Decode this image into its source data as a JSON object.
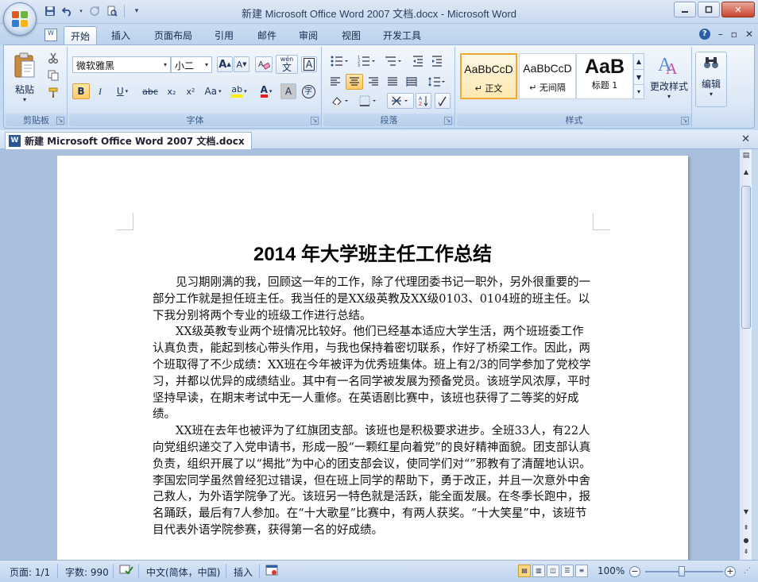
{
  "window": {
    "title": "新建 Microsoft Office Word 2007 文档.docx - Microsoft Word"
  },
  "ribbon_tabs": [
    "开始",
    "插入",
    "页面布局",
    "引用",
    "邮件",
    "审阅",
    "视图",
    "开发工具"
  ],
  "clipboard": {
    "paste_label": "粘贴",
    "group_label": "剪贴板"
  },
  "font": {
    "family": "微软雅黑",
    "size": "小二",
    "group_label": "字体",
    "grow_label": "A",
    "shrink_label": "A",
    "bold_label": "B",
    "italic_label": "I",
    "underline_label": "U",
    "strike_label": "abc",
    "subscript_label": "x₂",
    "superscript_label": "x²",
    "case_label": "Aa",
    "highlight_label": "ab",
    "color_label": "A",
    "shade_label": "A",
    "wen_label": "wén",
    "wen_char": "文",
    "border_char_label": "A",
    "enclose_label": "字"
  },
  "paragraph": {
    "group_label": "段落"
  },
  "styles": {
    "group_label": "样式",
    "items": [
      {
        "sample": "AaBbCcD",
        "name": "↵ 正文"
      },
      {
        "sample": "AaBbCcD",
        "name": "↵ 无间隔"
      },
      {
        "sample": "AaB",
        "name": "标题 1"
      }
    ],
    "change_label": "更改样式"
  },
  "editing": {
    "label": "编辑"
  },
  "doc_tab": {
    "label": "新建 Microsoft Office Word 2007 文档.docx"
  },
  "document": {
    "title": "2014 年大学班主任工作总结",
    "paragraphs": [
      "见习期刚满的我，回顾这一年的工作，除了代理团委书记一职外，另外很重要的一部分工作就是担任班主任。我当任的是XX级英教及XX级0103、0104班的班主任。以下我分别将两个专业的班级工作进行总结。",
      "XX级英教专业两个班情况比较好。他们已经基本适应大学生活，两个班班委工作认真负责，能起到核心带头作用，与我也保持着密切联系，作好了桥梁工作。因此，两个班取得了不少成绩：XX班在今年被评为优秀班集体。班上有2/3的同学参加了党校学习，并都以优异的成绩结业。其中有一名同学被发展为预备党员。该班学风浓厚，平时坚持早读，在期末考试中无一人重修。在英语剧比赛中，该班也获得了二等奖的好成绩。",
      "XX班在去年也被评为了红旗团支部。该班也是积极要求进步。全班33人，有22人向党组织递交了入党申请书，形成一股“一颗红星向着党”的良好精神面貌。团支部认真负责，组织开展了以“揭批”为中心的团支部会议，使同学们对“”邪教有了清醒地认识。李国宏同学虽然曾经犯过错误，但在班上同学的帮助下，勇于改正，并且一次意外中舍己救人，为外语学院争了光。该班另一特色就是活跃，能全面发展。在冬季长跑中，报名踊跃，最后有7人参加。在“十大歌星”比赛中，有两人获奖。“十大笑星”中，该班节目代表外语学院参赛，获得第一名的好成绩。"
    ]
  },
  "status": {
    "page": "页面: 1/1",
    "words": "字数: 990",
    "language": "中文(简体，中国)",
    "mode": "插入",
    "zoom": "100%"
  }
}
